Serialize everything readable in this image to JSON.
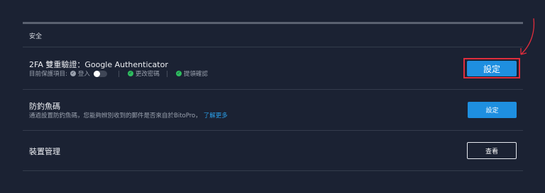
{
  "security": {
    "section_title": "安全",
    "twofa": {
      "title": "2FA 雙重驗證：Google Authenticator",
      "protect_label": "目前保護項目:",
      "login_label": "登入",
      "login_toggle_on": false,
      "change_password_label": "更改密碼",
      "withdraw_confirm_label": "提領確認",
      "button_label": "設定"
    },
    "anti_phishing": {
      "title": "防釣魚碼",
      "description": "通過設置防釣魚碼，您能夠辨別收到的郵件是否來自於BitoPro，",
      "link_label": "了解更多",
      "button_label": "設定"
    },
    "device_management": {
      "title": "裝置管理",
      "button_label": "查看"
    }
  },
  "colors": {
    "background": "#1b2233",
    "primary_button": "#1e8fe0",
    "link": "#2aa0ea",
    "check_green": "#2ebd5f",
    "annotation_red": "#e02d3c"
  },
  "icons": {
    "check_gray": "check-circle-icon",
    "check_green": "check-circle-icon",
    "annotation": "curved-arrow-icon"
  }
}
